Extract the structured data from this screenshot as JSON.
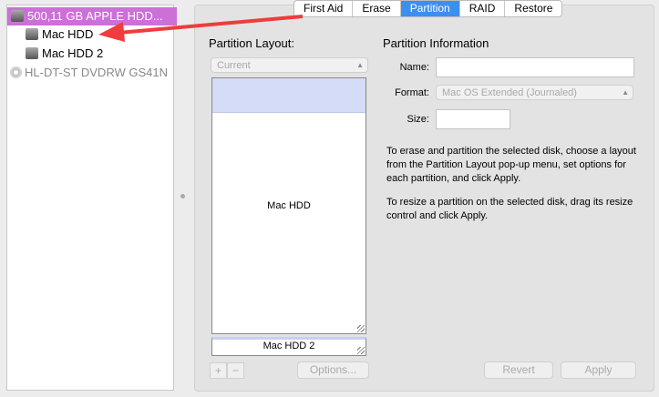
{
  "sidebar": {
    "items": [
      {
        "label": "500,11 GB APPLE HDD...",
        "icon": "hard-disk-icon",
        "selected": true
      },
      {
        "label": "Mac HDD",
        "icon": "hard-disk-icon"
      },
      {
        "label": "Mac HDD 2",
        "icon": "hard-disk-icon"
      },
      {
        "label": "HL-DT-ST DVDRW GS41N",
        "icon": "optical-disc-icon"
      }
    ]
  },
  "tabs": [
    "First Aid",
    "Erase",
    "Partition",
    "RAID",
    "Restore"
  ],
  "active_tab": "Partition",
  "layout": {
    "title": "Partition Layout:",
    "select": "Current",
    "partitions": [
      "Mac HDD",
      "Mac HDD 2"
    ],
    "add": "+",
    "remove": "−",
    "options": "Options..."
  },
  "info": {
    "title": "Partition Information",
    "name_label": "Name:",
    "name_value": "",
    "format_label": "Format:",
    "format_value": "Mac OS Extended (Journaled)",
    "size_label": "Size:",
    "size_value": "",
    "text1": "To erase and partition the selected disk, choose a layout from the Partition Layout pop-up menu, set options for each partition, and click Apply.",
    "text2": "To resize a partition on the selected disk, drag its resize control and click Apply."
  },
  "buttons": {
    "revert": "Revert",
    "apply": "Apply"
  },
  "colors": {
    "selection": "#cc70d8",
    "tab_active": "#3b8ff0",
    "arrow": "#f03c3c"
  }
}
